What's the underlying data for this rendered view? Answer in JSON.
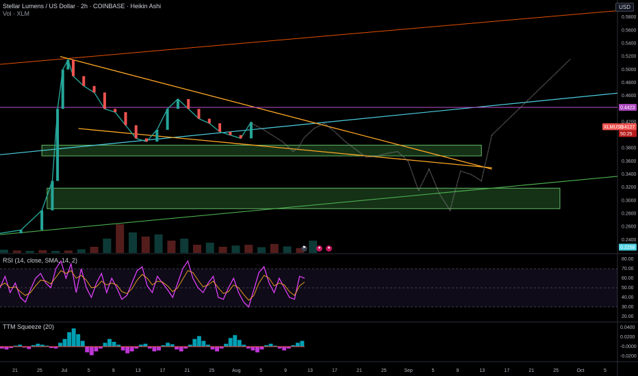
{
  "header": {
    "symbol_line": "Stellar Lumens / US Dollar · 2h · COINBASE · Heikin Ashi",
    "volume_line": "Vol · XLM",
    "currency": "USD"
  },
  "price_tags": {
    "level_line": "0.4423",
    "symbol": "XLMUSD",
    "last_price": "0.4127",
    "countdown": "50:25",
    "low_tag": "0.2258"
  },
  "indicators": {
    "rsi_label": "RSI (14, close, SMA, 14, 2)",
    "ttm_label": "TTM Squeeze (20)"
  },
  "colors": {
    "bull": "#26a69a",
    "bear": "#ef5350",
    "rsi_line": "#e040fb",
    "rsi_ma": "#f9a825",
    "fib_line": "#ab47bc",
    "cyan_line": "#4dd0e1",
    "green_line": "#4caf50",
    "red_line": "#e65100",
    "orange_line": "#ffa726"
  },
  "chart_data": [
    {
      "type": "line",
      "panel": "price",
      "title": "Stellar Lumens / US Dollar · 2h · COINBASE · Heikin Ashi",
      "y_ticks": [
        "0.5800",
        "0.5600",
        "0.5400",
        "0.5200",
        "0.5000",
        "0.4800",
        "0.4600",
        "0.4400",
        "0.4200",
        "0.4000",
        "0.3800",
        "0.3600",
        "0.3400",
        "0.3200",
        "0.3000",
        "0.2800",
        "0.2600",
        "0.2400"
      ],
      "x_ticks": [
        "21",
        "25",
        "Jul",
        "5",
        "9",
        "13",
        "17",
        "21",
        "25",
        "Aug",
        "5",
        "9",
        "13",
        "17",
        "21",
        "25",
        "Sep",
        "5",
        "9",
        "13",
        "17",
        "21",
        "25",
        "Oct",
        "5"
      ],
      "ylim": [
        0.22,
        0.6
      ],
      "series": [
        {
          "x": [
            0,
            4,
            8,
            10,
            11,
            12,
            13,
            14,
            16,
            18,
            20,
            22,
            24,
            26,
            28,
            30,
            32,
            34,
            36,
            38,
            40,
            42,
            44,
            46,
            48
          ],
          "values": [
            0.25,
            0.255,
            0.285,
            0.33,
            0.44,
            0.5,
            0.515,
            0.49,
            0.475,
            0.465,
            0.44,
            0.435,
            0.415,
            0.395,
            0.39,
            0.408,
            0.44,
            0.455,
            0.44,
            0.425,
            0.418,
            0.405,
            0.4,
            0.395,
            0.42
          ]
        },
        {
          "x": [
            48,
            50,
            52,
            54,
            56,
            57,
            58,
            60,
            62,
            64,
            66,
            68,
            70,
            72,
            74,
            76,
            78,
            80,
            82,
            84,
            86,
            88,
            90,
            92,
            94
          ],
          "values": [
            0.418,
            0.41,
            0.4,
            0.39,
            0.375,
            0.38,
            0.395,
            0.41,
            0.418,
            0.405,
            0.39,
            0.378,
            0.366,
            0.368,
            0.372,
            0.375,
            0.36,
            0.315,
            0.348,
            0.31,
            0.285,
            0.345,
            0.34,
            0.33,
            0.4
          ]
        }
      ],
      "volume": [
        0.08,
        0.06,
        0.05,
        0.07,
        0.05,
        0.06,
        0.09,
        0.15,
        0.35,
        0.7,
        0.5,
        0.4,
        0.45,
        0.3,
        0.35,
        0.2,
        0.25,
        0.15,
        0.18,
        0.2,
        0.14,
        0.22,
        0.16,
        0.12,
        0.3
      ],
      "annotations": {
        "horizontal_level": 0.4423,
        "resistance_trend": [
          [
            11.5,
            0.52
          ],
          [
            94,
            0.348
          ]
        ],
        "support_trend": [
          [
            15,
            0.41
          ],
          [
            94,
            0.35
          ]
        ],
        "red_channel": [
          [
            0,
            0.508
          ],
          [
            118,
            0.59
          ]
        ],
        "cyan_channel": [
          [
            0,
            0.37
          ],
          [
            118,
            0.464
          ]
        ],
        "green_channel": [
          [
            0,
            0.248
          ],
          [
            118,
            0.337
          ]
        ],
        "upper_zone": [
          [
            8,
            0.3846
          ],
          [
            92,
            0.3682
          ]
        ],
        "lower_zone": [
          [
            9,
            0.3189
          ],
          [
            107,
            0.2876
          ]
        ],
        "projection_end": [
          109,
          0.516
        ]
      }
    },
    {
      "type": "line",
      "panel": "rsi",
      "title": "RSI (14, close, SMA, 14, 2)",
      "y_ticks": [
        "80.00",
        "70.00",
        "60.00",
        "50.00",
        "40.00",
        "30.00",
        "20.00"
      ],
      "ylim": [
        15,
        85
      ],
      "bands": [
        70,
        50,
        30
      ],
      "series": [
        {
          "name": "RSI",
          "values": [
            50,
            62,
            45,
            55,
            40,
            35,
            48,
            60,
            65,
            55,
            50,
            70,
            78,
            60,
            75,
            45,
            70,
            50,
            40,
            55,
            65,
            45,
            60,
            50,
            38,
            42,
            55,
            68,
            72,
            52,
            45,
            62,
            55,
            48,
            40,
            55,
            70,
            78,
            60,
            50,
            45,
            55,
            62,
            40,
            38,
            50,
            60,
            45,
            35,
            30,
            48,
            66,
            72,
            55,
            45,
            60,
            50,
            40,
            38,
            62,
            60
          ]
        },
        {
          "name": "SMA",
          "values": [
            52,
            55,
            50,
            51,
            46,
            42,
            45,
            52,
            58,
            57,
            54,
            61,
            68,
            65,
            68,
            60,
            63,
            58,
            50,
            51,
            57,
            53,
            55,
            53,
            46,
            44,
            49,
            58,
            64,
            60,
            53,
            57,
            56,
            52,
            46,
            50,
            59,
            68,
            66,
            58,
            51,
            53,
            57,
            50,
            44,
            46,
            53,
            50,
            43,
            37,
            42,
            55,
            63,
            60,
            52,
            55,
            53,
            46,
            42,
            52,
            56
          ]
        }
      ]
    },
    {
      "type": "bar",
      "panel": "ttm",
      "title": "TTM Squeeze (20)",
      "y_ticks": [
        "0.0400",
        "0.0200",
        "-0.0000",
        "-0.0200"
      ],
      "ylim": [
        -0.03,
        0.05
      ],
      "values": [
        -0.004,
        -0.006,
        -0.003,
        0.002,
        0.004,
        -0.002,
        -0.005,
        0.003,
        0.006,
        0.004,
        0.002,
        -0.003,
        -0.004,
        0.008,
        0.016,
        0.03,
        0.038,
        0.026,
        0.012,
        -0.012,
        -0.018,
        -0.01,
        -0.004,
        0.008,
        0.016,
        0.01,
        0.004,
        -0.008,
        -0.014,
        -0.01,
        -0.004,
        0.004,
        0.006,
        -0.004,
        -0.01,
        -0.008,
        0.003,
        0.008,
        0.005,
        -0.006,
        -0.01,
        -0.004,
        0.004,
        0.016,
        0.022,
        0.012,
        0.004,
        -0.006,
        -0.01,
        -0.004,
        0.006,
        0.018,
        0.024,
        0.014,
        0.004,
        -0.004,
        -0.008,
        -0.012,
        -0.006,
        0.003,
        0.006,
        0.002,
        -0.004,
        -0.008,
        -0.004,
        0.003,
        0.008,
        0.012
      ]
    }
  ]
}
